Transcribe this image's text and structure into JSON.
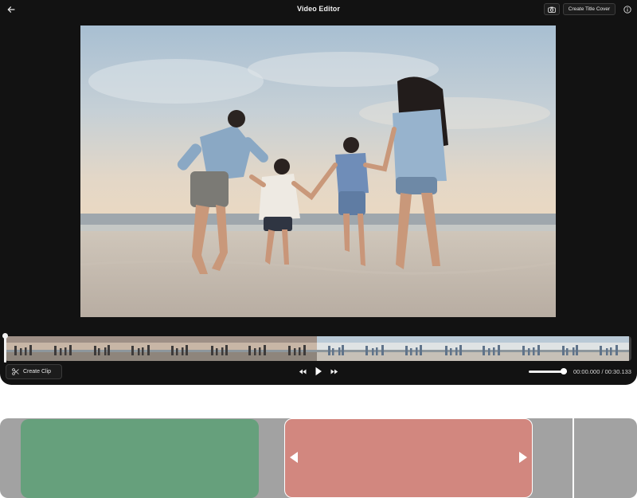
{
  "header": {
    "title": "Video Editor",
    "back_icon": "arrow-left-icon",
    "camera_icon": "camera-icon",
    "create_title_cover_label": "Create Title Cover",
    "info_icon": "info-icon"
  },
  "preview": {
    "scene": "family-running-on-beach-at-sunset"
  },
  "timeline": {
    "create_clip_label": "Create Clip",
    "create_clip_icon": "scissors-icon",
    "rewind_icon": "rewind-icon",
    "play_icon": "play-icon",
    "forward_icon": "fast-forward-icon",
    "volume_level": 0.92,
    "timecode": "00:00.000 / 00:30.133"
  },
  "colors": {
    "editor_bg": "#121212",
    "segment_green": "#66a07c",
    "segment_red": "#d2877f",
    "track_bg": "#a2a2a2"
  }
}
